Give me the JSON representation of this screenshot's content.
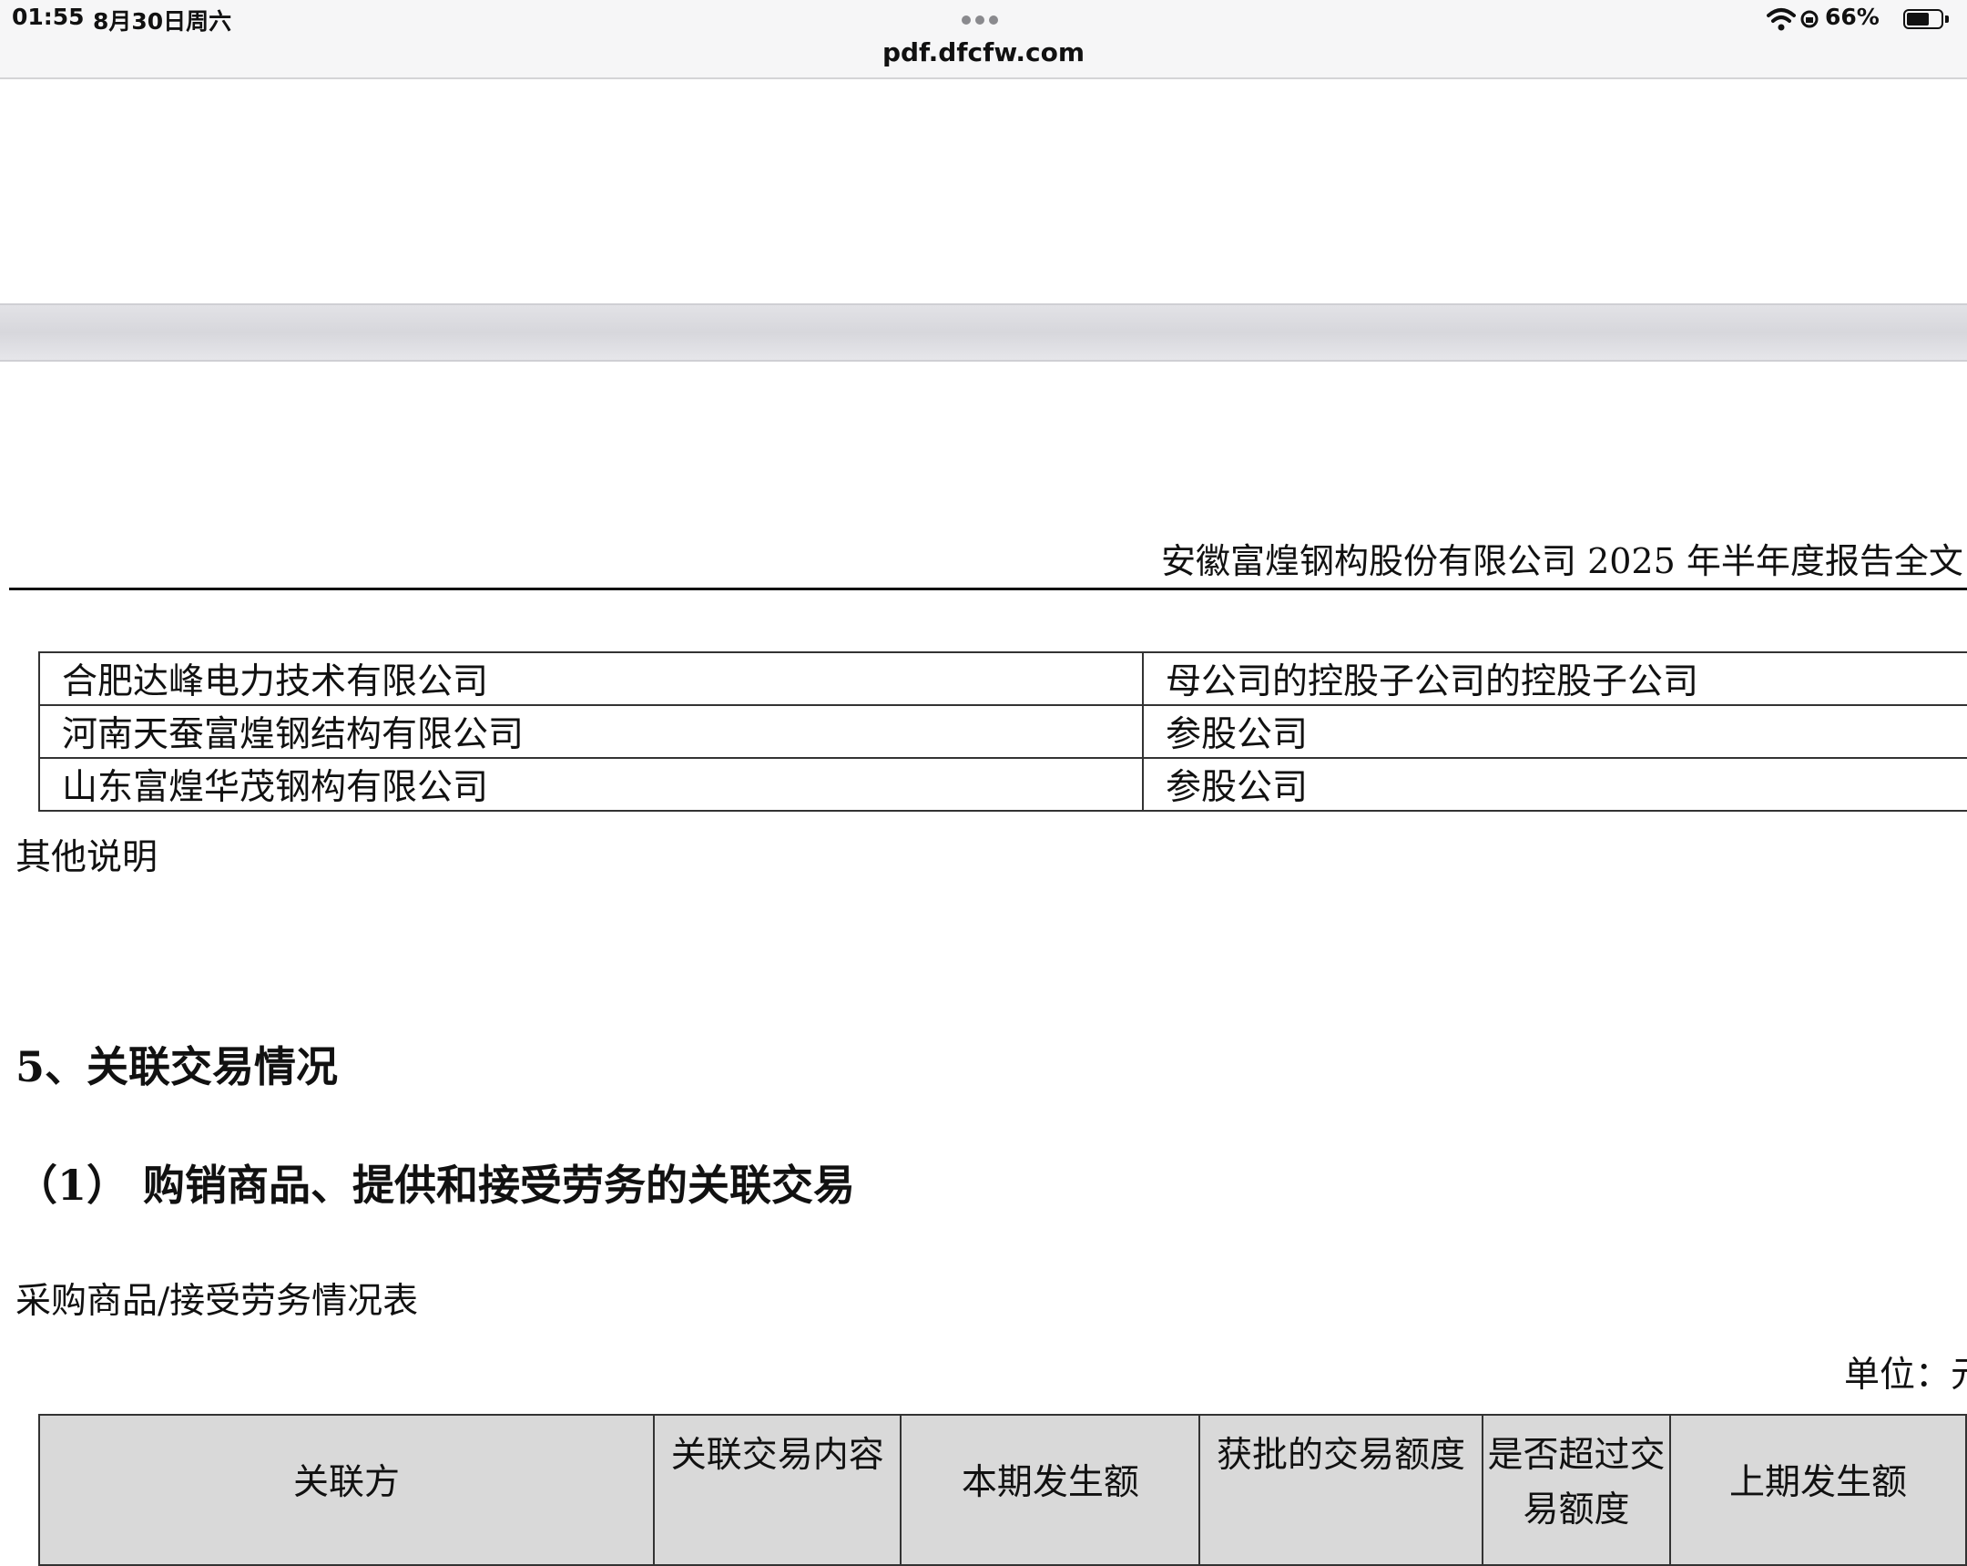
{
  "status_bar": {
    "time": "01:55",
    "date": "8月30日周六",
    "url": "pdf.dfcfw.com",
    "battery_percent": "66%",
    "battery_level": 0.66,
    "icons": [
      "more-dots-icon",
      "wifi-icon",
      "rotation-lock-icon",
      "battery-icon"
    ]
  },
  "document": {
    "header_title": "安徽富煌钢构股份有限公司 2025 年半年度报告全文",
    "related_parties": [
      {
        "name": "合肥达峰电力技术有限公司",
        "relation": "母公司的控股子公司的控股子公司"
      },
      {
        "name": "河南天蚕富煌钢结构有限公司",
        "relation": "参股公司"
      },
      {
        "name": "山东富煌华茂钢构有限公司",
        "relation": "参股公司"
      }
    ],
    "other_note": "其他说明",
    "section5_title": "5、关联交易情况",
    "subsection1_title": "（1） 购销商品、提供和接受劳务的关联交易",
    "table_name": "采购商品/接受劳务情况表",
    "unit_label": "单位：元",
    "purchase_table_headers": [
      "关联方",
      "关联交易内容",
      "本期发生额",
      "获批的交易额度",
      "是否超过交易额度",
      "上期发生额"
    ]
  }
}
